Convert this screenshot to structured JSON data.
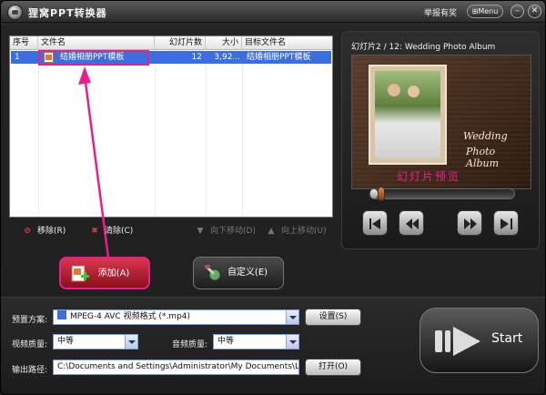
{
  "app": {
    "title": "狸窝PPT转换器",
    "report_link": "举报有奖",
    "menu_label": "Menu",
    "minimize": "–",
    "close": "✕"
  },
  "filelist": {
    "columns": [
      "序号",
      "文件名",
      "幻灯片数",
      "大小",
      "目标文件名"
    ],
    "rows": [
      {
        "index": "1",
        "file_name": "结婚相册PPT模板",
        "slides": "12",
        "size": "3,92...",
        "target": "结婚相册PPT模板"
      }
    ]
  },
  "list_actions": {
    "remove": "移除(R)",
    "clear": "清除(C)",
    "move_down": "向下移动(D)",
    "move_up": "向上移动(U)"
  },
  "buttons": {
    "add": "添加(A)",
    "custom": "自定义(E)"
  },
  "preview": {
    "title": "幻灯片2 / 12: Wedding Photo Album",
    "slide_text_1": "Wedding",
    "slide_text_2": "Photo Album",
    "label": "幻灯片预览",
    "progress": 0.05
  },
  "settings": {
    "preset_label": "预置方案:",
    "preset_value": "MPEG-4 AVC 视频格式 (*.mp4)",
    "settings_button": "设置(S)",
    "video_quality_label": "视频质量:",
    "video_quality_value": "中等",
    "audio_quality_label": "音频质量:",
    "audio_quality_value": "中等",
    "output_label": "输出路径:",
    "output_path": "C:\\Documents and Settings\\Administrator\\My Documents\\Leawo\\Po",
    "open_button": "打开(O)"
  },
  "start": {
    "label": "Start"
  },
  "colors": {
    "annotation": "#e91e8c",
    "selection": "#3b6fe0",
    "add_button": "#c0283a"
  }
}
